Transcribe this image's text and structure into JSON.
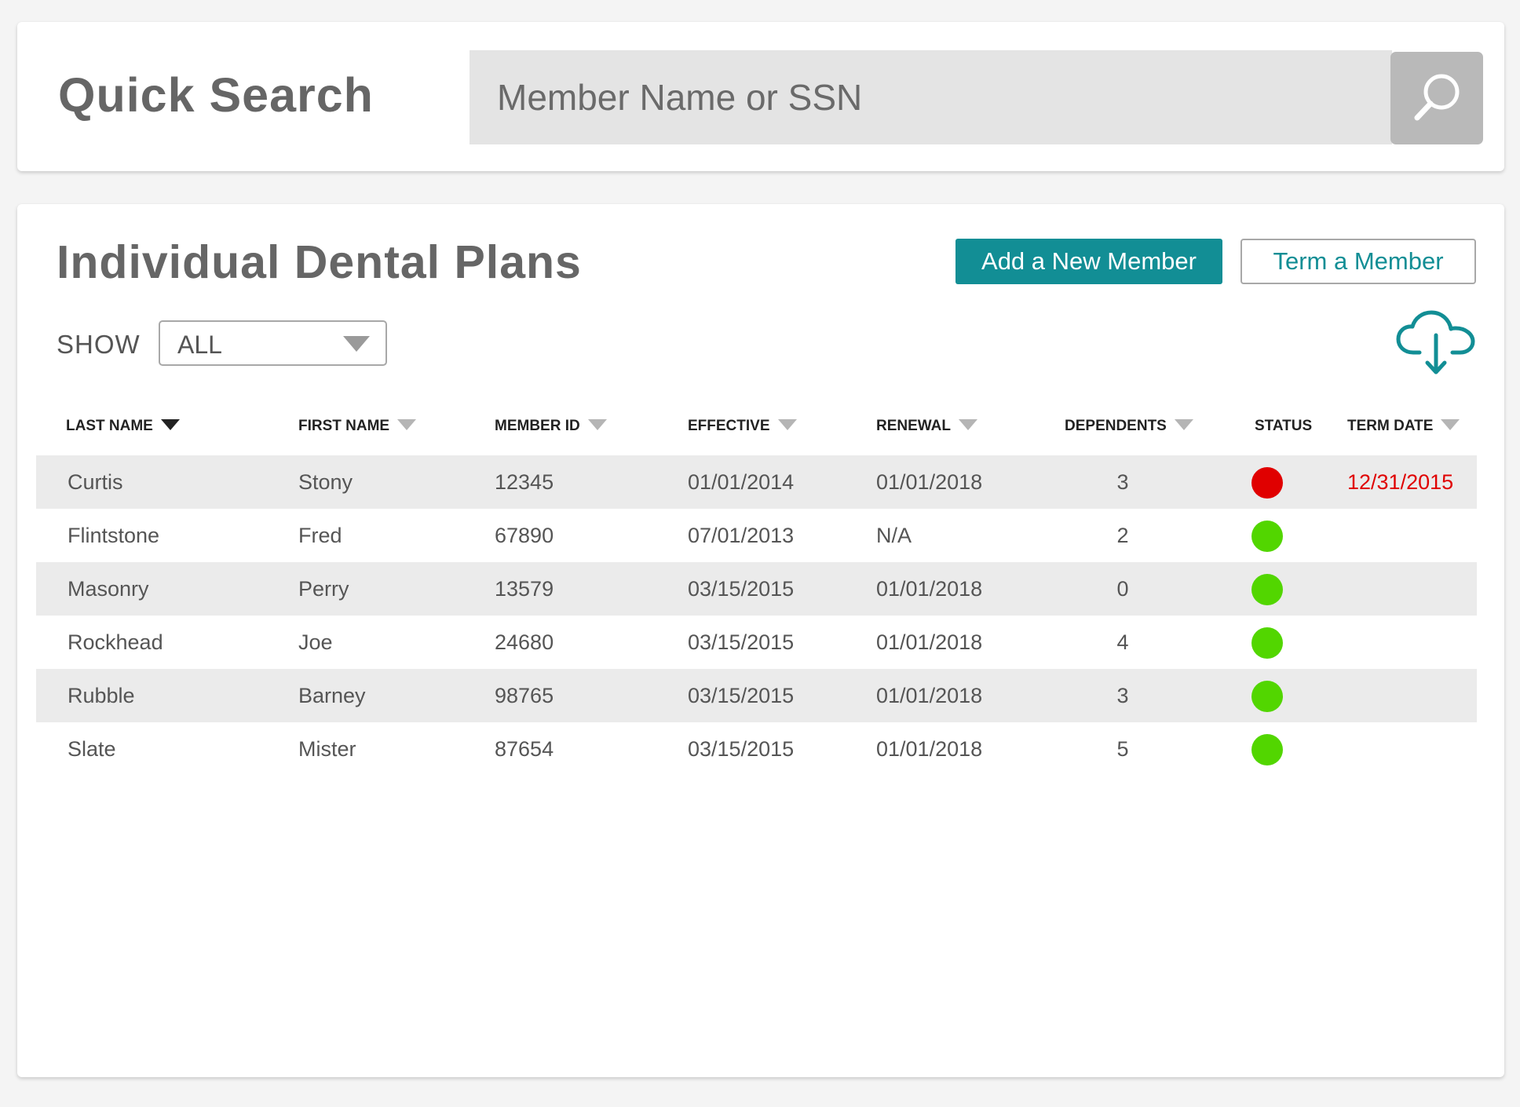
{
  "quick_search": {
    "title": "Quick Search",
    "placeholder": "Member Name or SSN",
    "value": "",
    "search_button_icon": "magnifier-icon"
  },
  "plans": {
    "title": "Individual Dental Plans",
    "add_button_label": "Add a New Member",
    "term_button_label": "Term a Member",
    "show_label": "SHOW",
    "show_value": "ALL",
    "download_icon": "cloud-download-icon"
  },
  "table": {
    "columns": [
      {
        "label": "LAST NAME",
        "sortable": true,
        "active_sort": true
      },
      {
        "label": "FIRST NAME",
        "sortable": true,
        "active_sort": false
      },
      {
        "label": "MEMBER ID",
        "sortable": true,
        "active_sort": false
      },
      {
        "label": "EFFECTIVE",
        "sortable": true,
        "active_sort": false
      },
      {
        "label": "RENEWAL",
        "sortable": true,
        "active_sort": false
      },
      {
        "label": "DEPENDENTS",
        "sortable": true,
        "active_sort": false
      },
      {
        "label": "STATUS",
        "sortable": false,
        "active_sort": false
      },
      {
        "label": "TERM DATE",
        "sortable": true,
        "active_sort": false
      }
    ],
    "rows": [
      {
        "last": "Curtis",
        "first": "Stony",
        "id": "12345",
        "effective": "01/01/2014",
        "renewal": "01/01/2018",
        "dependents": "3",
        "status": "terminated",
        "term_date": "12/31/2015"
      },
      {
        "last": "Flintstone",
        "first": "Fred",
        "id": "67890",
        "effective": "07/01/2013",
        "renewal": "N/A",
        "dependents": "2",
        "status": "active",
        "term_date": ""
      },
      {
        "last": "Masonry",
        "first": "Perry",
        "id": "13579",
        "effective": "03/15/2015",
        "renewal": "01/01/2018",
        "dependents": "0",
        "status": "active",
        "term_date": ""
      },
      {
        "last": "Rockhead",
        "first": "Joe",
        "id": "24680",
        "effective": "03/15/2015",
        "renewal": "01/01/2018",
        "dependents": "4",
        "status": "active",
        "term_date": ""
      },
      {
        "last": "Rubble",
        "first": "Barney",
        "id": "98765",
        "effective": "03/15/2015",
        "renewal": "01/01/2018",
        "dependents": "3",
        "status": "active",
        "term_date": ""
      },
      {
        "last": "Slate",
        "first": "Mister",
        "id": "87654",
        "effective": "03/15/2015",
        "renewal": "01/01/2018",
        "dependents": "5",
        "status": "active",
        "term_date": ""
      }
    ]
  },
  "colors": {
    "accent": "#128e95",
    "status_active": "#52d600",
    "status_terminated": "#e00000",
    "row_shade": "#ebebeb"
  }
}
